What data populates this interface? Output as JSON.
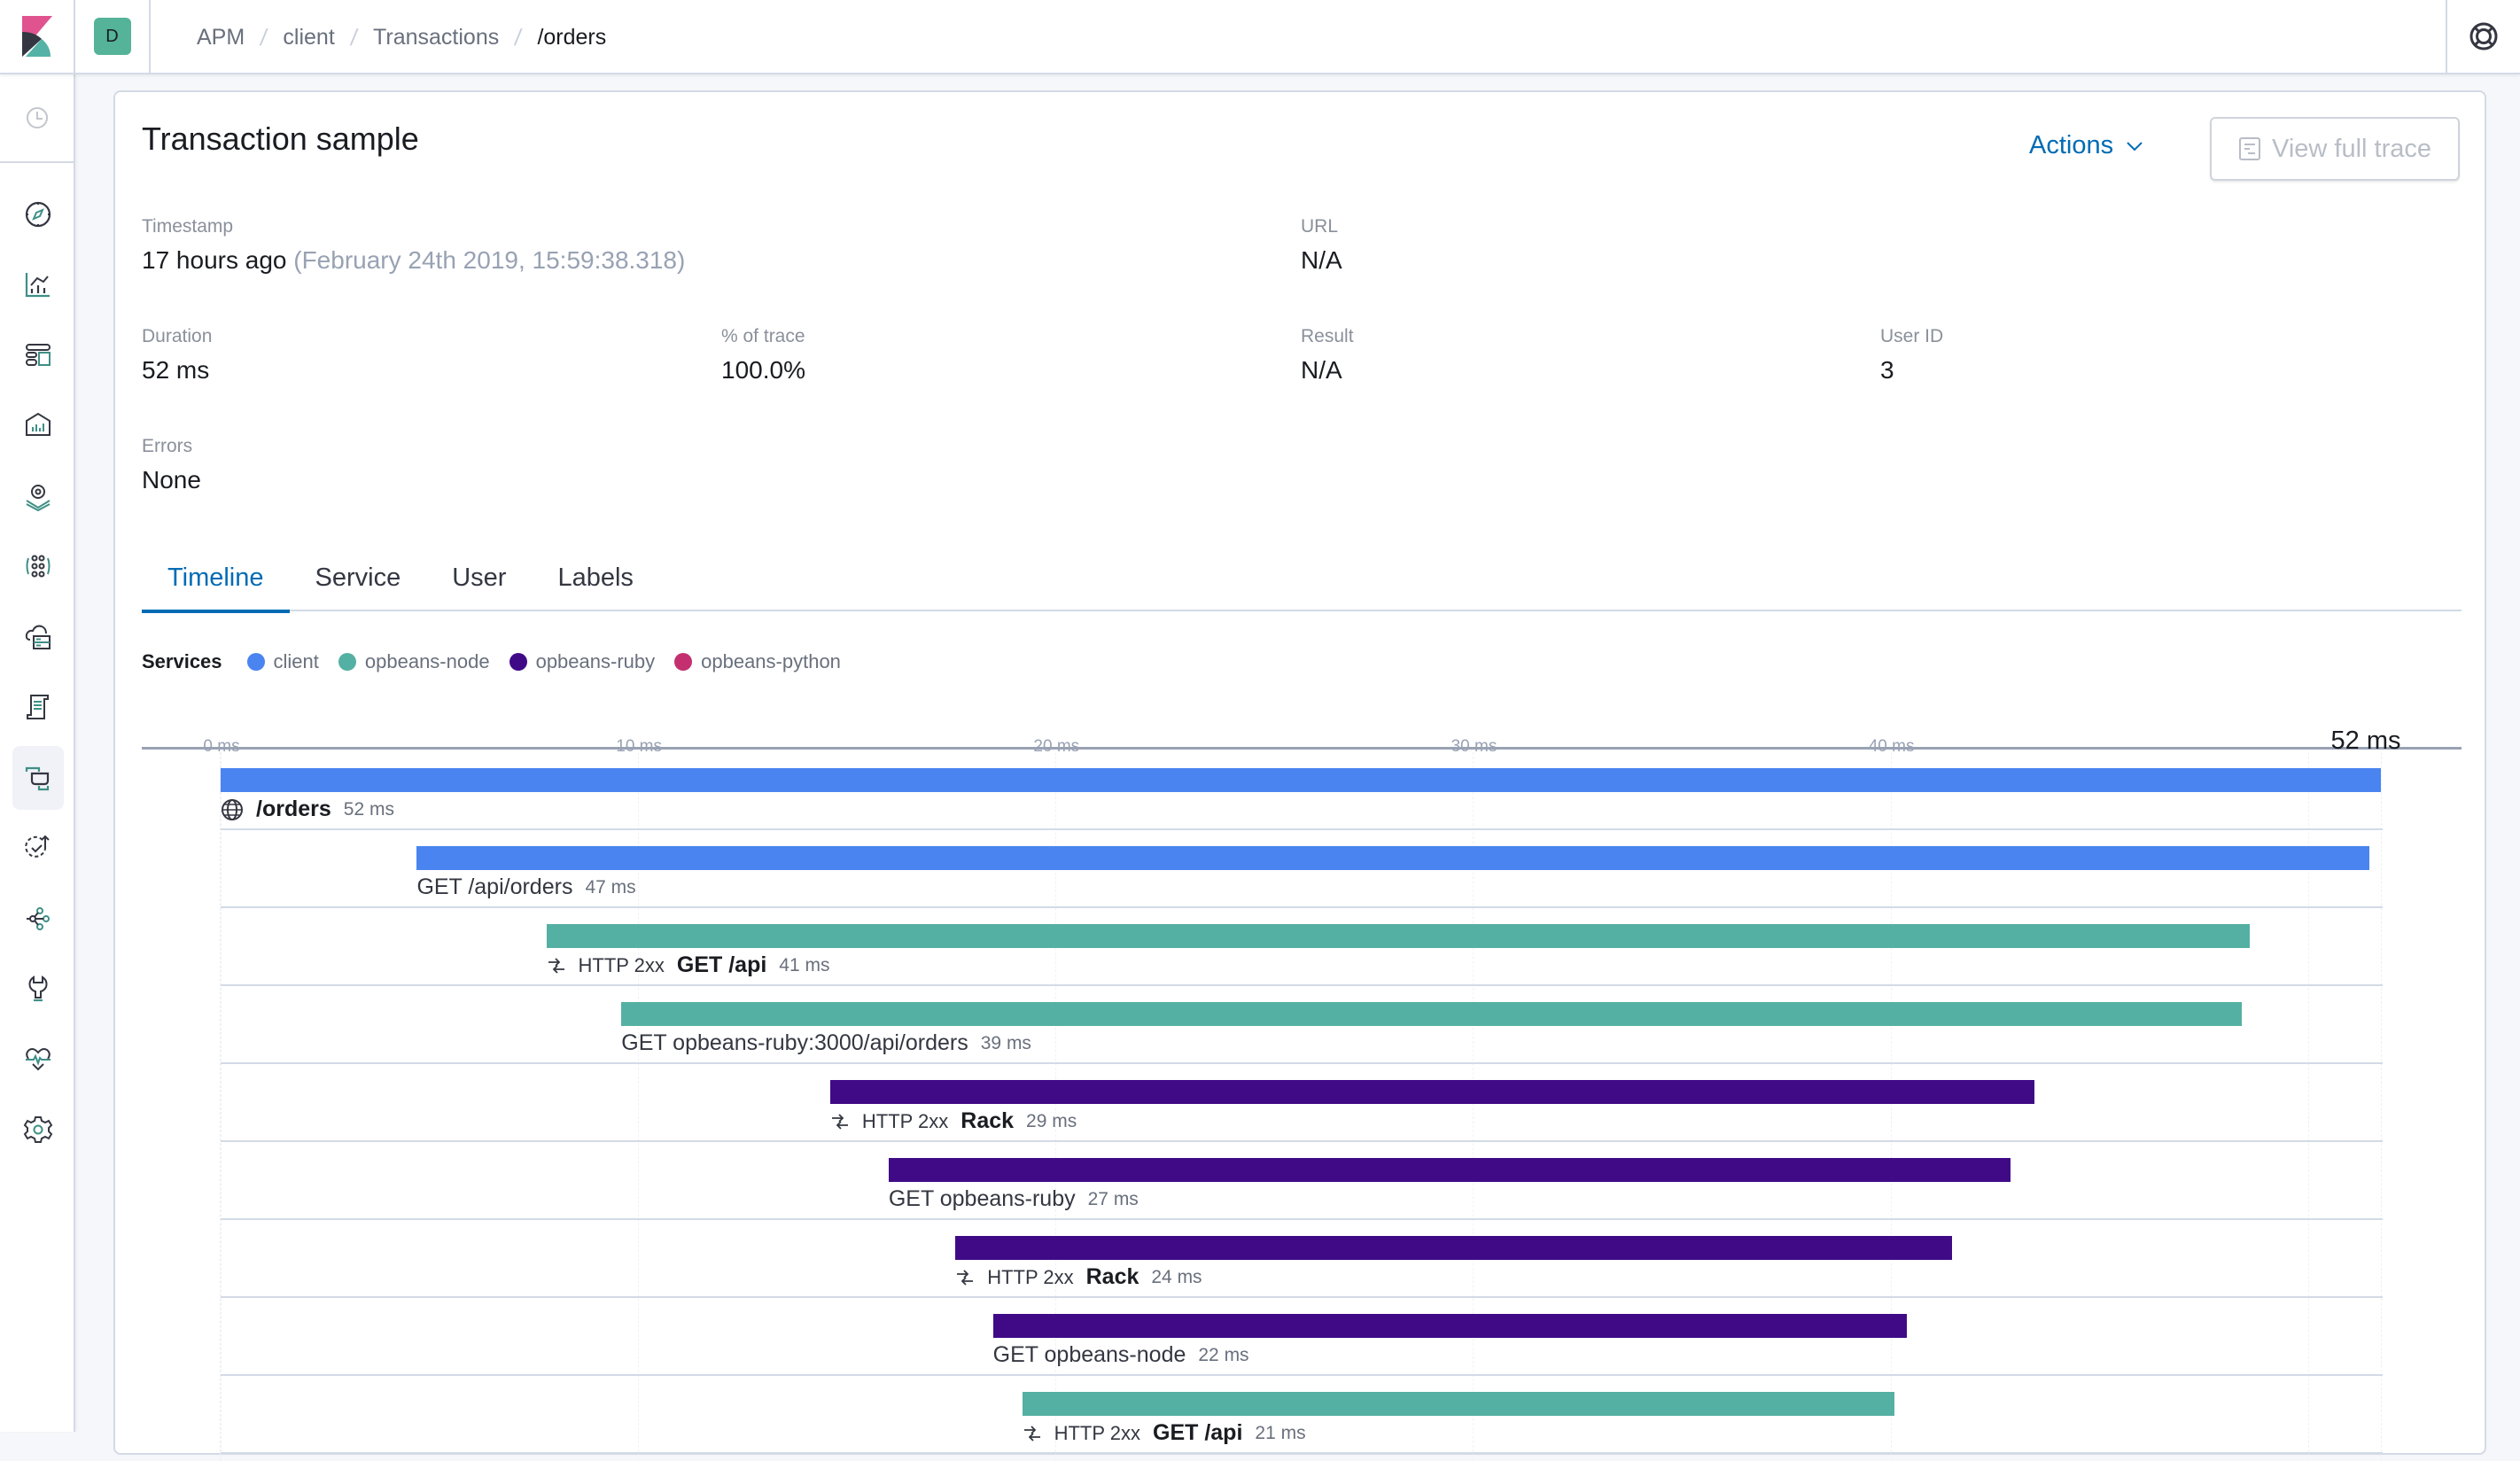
{
  "header": {
    "space_initial": "D",
    "breadcrumbs": [
      "APM",
      "client",
      "Transactions",
      "/orders"
    ]
  },
  "sidebar": {
    "recent_icon": "clock-icon",
    "items": [
      {
        "name": "discover",
        "icon": "compass-icon"
      },
      {
        "name": "visualize",
        "icon": "visualize-icon"
      },
      {
        "name": "dashboard",
        "icon": "dashboard-icon"
      },
      {
        "name": "canvas",
        "icon": "canvas-icon"
      },
      {
        "name": "maps",
        "icon": "maps-icon"
      },
      {
        "name": "machine-learning",
        "icon": "ml-icon"
      },
      {
        "name": "infrastructure",
        "icon": "infrastructure-icon"
      },
      {
        "name": "logs",
        "icon": "logs-icon"
      },
      {
        "name": "apm",
        "icon": "apm-icon",
        "active": true
      },
      {
        "name": "uptime",
        "icon": "uptime-icon"
      },
      {
        "name": "graph",
        "icon": "graph-icon"
      },
      {
        "name": "dev-tools",
        "icon": "wrench-icon"
      },
      {
        "name": "monitoring",
        "icon": "heartbeat-icon"
      },
      {
        "name": "management",
        "icon": "gear-icon"
      }
    ]
  },
  "panel": {
    "title": "Transaction sample",
    "actions_label": "Actions",
    "view_full_trace_label": "View full trace",
    "fields": {
      "timestamp": {
        "label": "Timestamp",
        "value": "17 hours ago",
        "detail": "(February 24th 2019, 15:59:38.318)"
      },
      "url": {
        "label": "URL",
        "value": "N/A"
      },
      "duration": {
        "label": "Duration",
        "value": "52 ms"
      },
      "pct_trace": {
        "label": "% of trace",
        "value": "100.0%"
      },
      "result": {
        "label": "Result",
        "value": "N/A"
      },
      "user_id": {
        "label": "User ID",
        "value": "3"
      },
      "errors": {
        "label": "Errors",
        "value": "None"
      }
    },
    "tabs": [
      "Timeline",
      "Service",
      "User",
      "Labels"
    ],
    "active_tab": "Timeline"
  },
  "legend": {
    "title": "Services",
    "items": [
      {
        "name": "client",
        "color": "#4a84f0"
      },
      {
        "name": "opbeans-node",
        "color": "#54b0a2"
      },
      {
        "name": "opbeans-ruby",
        "color": "#400a87"
      },
      {
        "name": "opbeans-python",
        "color": "#c4306f"
      }
    ]
  },
  "chart_data": {
    "type": "bar",
    "title": "Timeline",
    "xlabel": "",
    "ylabel": "",
    "xlim": [
      0,
      52
    ],
    "x_ticks": [
      "0 ms",
      "10 ms",
      "20 ms",
      "30 ms",
      "40 ms"
    ],
    "x_end_label": "52 ms",
    "grid": true,
    "legend_position": "top-left",
    "rows": [
      {
        "service": "client",
        "kind": "transaction",
        "icon": "globe-icon",
        "http": "",
        "name": "/orders",
        "bold": true,
        "start_ms": 0,
        "duration_ms": 52,
        "duration_label": "52 ms"
      },
      {
        "service": "client",
        "kind": "span",
        "icon": "",
        "http": "",
        "name": "GET /api/orders",
        "bold": false,
        "start_ms": 4.7,
        "duration_ms": 47,
        "duration_label": "47 ms"
      },
      {
        "service": "opbeans-node",
        "kind": "transaction",
        "icon": "exchange-icon",
        "http": "HTTP 2xx",
        "name": "GET /api",
        "bold": true,
        "start_ms": 7.8,
        "duration_ms": 41,
        "duration_label": "41 ms"
      },
      {
        "service": "opbeans-node",
        "kind": "span",
        "icon": "",
        "http": "",
        "name": "GET opbeans-ruby:3000/api/orders",
        "bold": false,
        "start_ms": 9.6,
        "duration_ms": 39,
        "duration_label": "39 ms"
      },
      {
        "service": "opbeans-ruby",
        "kind": "transaction",
        "icon": "exchange-icon",
        "http": "HTTP 2xx",
        "name": "Rack",
        "bold": true,
        "start_ms": 14.6,
        "duration_ms": 29,
        "duration_label": "29 ms"
      },
      {
        "service": "opbeans-ruby",
        "kind": "span",
        "icon": "",
        "http": "",
        "name": "GET opbeans-ruby",
        "bold": false,
        "start_ms": 16.0,
        "duration_ms": 27,
        "duration_label": "27 ms"
      },
      {
        "service": "opbeans-ruby",
        "kind": "transaction",
        "icon": "exchange-icon",
        "http": "HTTP 2xx",
        "name": "Rack",
        "bold": true,
        "start_ms": 17.6,
        "duration_ms": 24,
        "duration_label": "24 ms"
      },
      {
        "service": "opbeans-ruby",
        "kind": "span",
        "icon": "",
        "http": "",
        "name": "GET opbeans-node",
        "bold": false,
        "start_ms": 18.5,
        "duration_ms": 22,
        "duration_label": "22 ms"
      },
      {
        "service": "opbeans-node",
        "kind": "transaction",
        "icon": "exchange-icon",
        "http": "HTTP 2xx",
        "name": "GET /api",
        "bold": true,
        "start_ms": 19.2,
        "duration_ms": 21,
        "duration_label": "21 ms"
      }
    ]
  }
}
